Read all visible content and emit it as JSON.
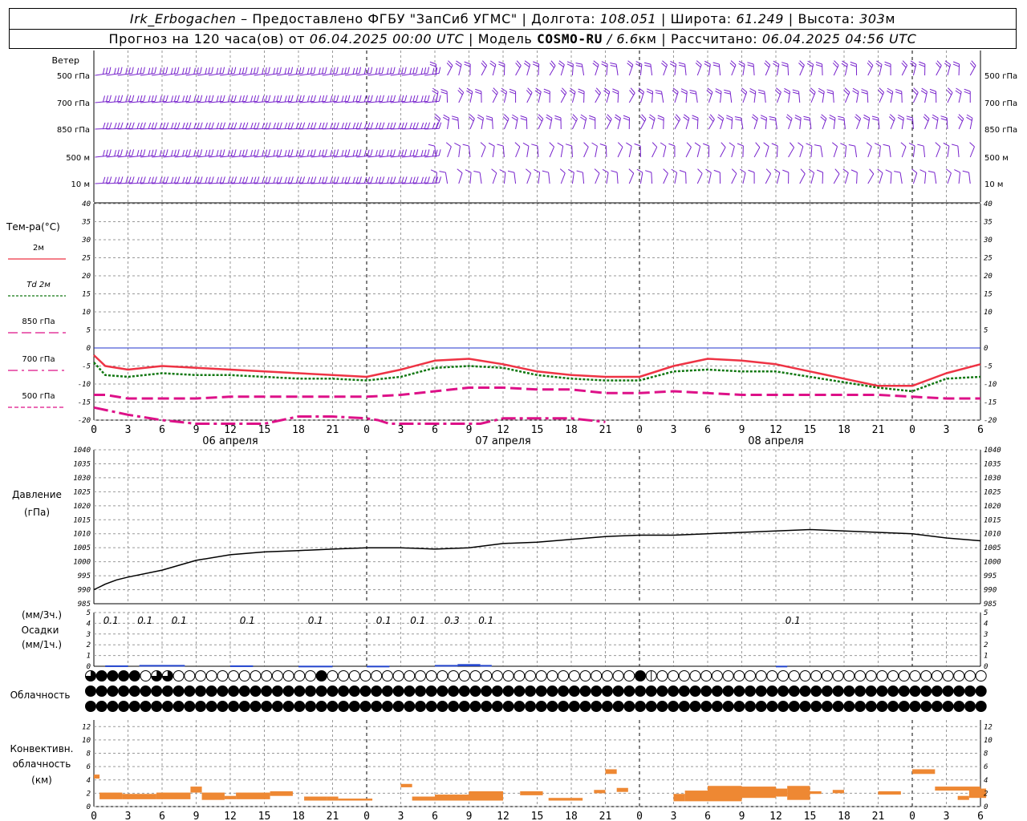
{
  "header": {
    "station": "Irk_Erbogachen",
    "provider": "– Предоставлено ФГБУ \"ЗапСиб УГМС\"",
    "lon_label": "| Долгота:",
    "lon": "108.051",
    "lat_label": "| Широта:",
    "lat": "61.249",
    "alt_label": "| Высота:",
    "alt": "303",
    "alt_unit": "м",
    "forecast_label": "Прогноз на 120 часа(ов) от",
    "forecast_time": "06.04.2025 00:00 UTC",
    "model_label": "| Модель",
    "model": "COSMO-RU",
    "model_res": "/ 6.6",
    "model_res_unit": "км",
    "calc_label": "| Рассчитано:",
    "calc_time": "06.04.2025 04:56 UTC"
  },
  "colors": {
    "t2m": "#ee3344",
    "td2m": "#117711",
    "t850": "#dd1188",
    "t700": "#dd1188",
    "t500": "#dd1188",
    "wind": "#7722cc",
    "pressure": "#000000",
    "precip": "#2244cc",
    "convective": "#ee8833",
    "zero_line": "#2233cc",
    "grid": "#999999"
  },
  "time_axis": {
    "tick_labels": [
      "0",
      "3",
      "6",
      "9",
      "12",
      "15",
      "18",
      "21",
      "0",
      "3",
      "6",
      "9",
      "12",
      "15",
      "18",
      "21",
      "0",
      "3",
      "6",
      "9",
      "12",
      "15",
      "18",
      "21",
      "0",
      "3",
      "6"
    ],
    "day_labels": [
      "06 апреля",
      "07 апреля",
      "08 апреля"
    ]
  },
  "wind_panel": {
    "title": "Ветер",
    "levels": [
      "500 гПа",
      "700 гПа",
      "850 гПа",
      "500 м",
      "10 м"
    ]
  },
  "chart_data": [
    {
      "type": "line",
      "title": "Тем-ра(°C)",
      "ylim": [
        -20,
        40
      ],
      "y_ticks": [
        "40",
        "35",
        "30",
        "25",
        "20",
        "15",
        "10",
        "5",
        "0",
        "-5",
        "-10",
        "-15",
        "-20"
      ],
      "x_hours": [
        0,
        1,
        3,
        6,
        9,
        12,
        15,
        18,
        21,
        24,
        27,
        30,
        33,
        36,
        39,
        42,
        45,
        48,
        51,
        54,
        57,
        60,
        63,
        66,
        69,
        72,
        75,
        78
      ],
      "series": [
        {
          "name": "2м",
          "style": "solid",
          "values": [
            -2,
            -5,
            -6,
            -5,
            -5.5,
            -6,
            -6.5,
            -7,
            -7.5,
            -8,
            -6,
            -3.5,
            -3,
            -4.5,
            -6.5,
            -7.5,
            -8,
            -8,
            -5,
            -3,
            -3.5,
            -4.5,
            -6.5,
            -8.5,
            -10.5,
            -10.5,
            -7,
            -4.5
          ]
        },
        {
          "name": "Td 2м",
          "style": "dotted",
          "values": [
            -4,
            -7.5,
            -8,
            -7,
            -7.5,
            -7.5,
            -8,
            -8.5,
            -8.5,
            -9,
            -8,
            -5.5,
            -5,
            -5.5,
            -7.5,
            -8.5,
            -9,
            -9,
            -6.5,
            -6,
            -6.5,
            -6.5,
            -8,
            -9.5,
            -11,
            -12,
            -8.5,
            -8
          ]
        },
        {
          "name": "850 гПа",
          "style": "dashed",
          "values": [
            -13,
            -13,
            -14,
            -14,
            -14,
            -13.5,
            -13.5,
            -13.5,
            -13.5,
            -13.5,
            -13,
            -12,
            -11,
            -11,
            -11.5,
            -11.5,
            -12.5,
            -12.5,
            -12,
            -12.5,
            -13,
            -13,
            -13,
            -13,
            -13,
            -13.5,
            -14,
            -14
          ]
        },
        {
          "name": "700 гПа",
          "style": "dashdot",
          "x_hours": [
            0,
            3,
            6,
            9,
            12,
            15,
            18,
            21,
            24,
            25,
            26,
            34,
            36,
            39,
            42,
            45
          ],
          "values": [
            -16.5,
            -18.5,
            -20,
            -21.5,
            -22.5,
            -21,
            -19,
            -19,
            -19.5,
            -20,
            -21,
            -21,
            -19.5,
            -19.5,
            -19.5,
            -20.5
          ]
        },
        {
          "name": "500 гПа",
          "style": "dash",
          "values": []
        }
      ]
    },
    {
      "type": "line",
      "title": "Давление",
      "unit": "(гПа)",
      "ylim": [
        985,
        1040
      ],
      "y_ticks": [
        "1040",
        "1035",
        "1030",
        "1025",
        "1020",
        "1015",
        "1010",
        "1005",
        "1000",
        "995",
        "990",
        "985"
      ],
      "series": [
        {
          "name": "Давление",
          "x_hours": [
            0,
            1,
            2,
            3,
            6,
            9,
            12,
            15,
            18,
            21,
            24,
            27,
            30,
            33,
            36,
            39,
            42,
            45,
            48,
            51,
            54,
            57,
            60,
            63,
            66,
            69,
            72,
            75,
            78
          ],
          "values": [
            990,
            992,
            993.5,
            994.5,
            997,
            1000.5,
            1002.5,
            1003.5,
            1004,
            1004.5,
            1005,
            1005,
            1004.5,
            1005,
            1006.5,
            1007,
            1008,
            1009,
            1009.5,
            1009.5,
            1010,
            1010.5,
            1011,
            1011.5,
            1011,
            1010.5,
            1010,
            1008.5,
            1007.5
          ]
        }
      ]
    },
    {
      "type": "bar",
      "title": "Осадки",
      "unit_3h": "(мм/3ч.)",
      "unit_1h": "(мм/1ч.)",
      "ylim": [
        0,
        5
      ],
      "y_ticks": [
        "5",
        "4",
        "3",
        "2",
        "1",
        "0"
      ],
      "labels": [
        {
          "x_hours": 1.5,
          "text": "0.1"
        },
        {
          "x_hours": 4.5,
          "text": "0.1"
        },
        {
          "x_hours": 7.5,
          "text": "0.1"
        },
        {
          "x_hours": 13.5,
          "text": "0.1"
        },
        {
          "x_hours": 19.5,
          "text": "0.1"
        },
        {
          "x_hours": 25.5,
          "text": "0.1"
        },
        {
          "x_hours": 28.5,
          "text": "0.1"
        },
        {
          "x_hours": 31.5,
          "text": "0.3"
        },
        {
          "x_hours": 34.5,
          "text": "0.1"
        },
        {
          "x_hours": 61.5,
          "text": "0.1"
        }
      ],
      "bars": [
        {
          "x_hours": 1,
          "w": 2,
          "value": 0.08
        },
        {
          "x_hours": 4,
          "w": 4,
          "value": 0.12
        },
        {
          "x_hours": 12,
          "w": 2,
          "value": 0.08
        },
        {
          "x_hours": 18,
          "w": 3,
          "value": 0.05
        },
        {
          "x_hours": 24,
          "w": 2,
          "value": 0.05
        },
        {
          "x_hours": 30,
          "w": 2,
          "value": 0.12
        },
        {
          "x_hours": 32,
          "w": 2,
          "value": 0.2
        },
        {
          "x_hours": 34,
          "w": 1,
          "value": 0.12
        },
        {
          "x_hours": 60,
          "w": 1,
          "value": 0.05
        }
      ]
    },
    {
      "type": "bar",
      "title": "Конвективн. облачность",
      "unit": "(км)",
      "ylim": [
        0,
        13
      ],
      "y_ticks": [
        "12",
        "10",
        "8",
        "6",
        "4",
        "2",
        "0"
      ],
      "bars": [
        {
          "x_hours": 0,
          "w": 0.5,
          "top": 4.8,
          "base": 4.2
        },
        {
          "x_hours": 0.5,
          "w": 2,
          "top": 2.1,
          "base": 1.1
        },
        {
          "x_hours": 2.5,
          "w": 3,
          "top": 1.9,
          "base": 1.1
        },
        {
          "x_hours": 5.5,
          "w": 3,
          "top": 2.1,
          "base": 1.1
        },
        {
          "x_hours": 8.5,
          "w": 1,
          "top": 3.0,
          "base": 2.1
        },
        {
          "x_hours": 9.5,
          "w": 2,
          "top": 2.1,
          "base": 1.0
        },
        {
          "x_hours": 11.5,
          "w": 1,
          "top": 1.6,
          "base": 1.1
        },
        {
          "x_hours": 12.5,
          "w": 3,
          "top": 2.1,
          "base": 1.1
        },
        {
          "x_hours": 15.5,
          "w": 2,
          "top": 2.3,
          "base": 1.6
        },
        {
          "x_hours": 18.5,
          "w": 2,
          "top": 1.5,
          "base": 0.9
        },
        {
          "x_hours": 20.5,
          "w": 1,
          "top": 1.5,
          "base": 0.9
        },
        {
          "x_hours": 21.5,
          "w": 3,
          "top": 1.2,
          "base": 0.9
        },
        {
          "x_hours": 27,
          "w": 1,
          "top": 3.4,
          "base": 2.9
        },
        {
          "x_hours": 28,
          "w": 2,
          "top": 1.5,
          "base": 0.9
        },
        {
          "x_hours": 30,
          "w": 3,
          "top": 1.8,
          "base": 0.9
        },
        {
          "x_hours": 33,
          "w": 3,
          "top": 2.3,
          "base": 0.9
        },
        {
          "x_hours": 37.5,
          "w": 2,
          "top": 2.3,
          "base": 1.7
        },
        {
          "x_hours": 40,
          "w": 3,
          "top": 1.3,
          "base": 0.9
        },
        {
          "x_hours": 44,
          "w": 1,
          "top": 2.5,
          "base": 2.0
        },
        {
          "x_hours": 45,
          "w": 1,
          "top": 5.6,
          "base": 4.9
        },
        {
          "x_hours": 46,
          "w": 1,
          "top": 2.8,
          "base": 2.2
        },
        {
          "x_hours": 51,
          "w": 1,
          "top": 1.9,
          "base": 0.8
        },
        {
          "x_hours": 52,
          "w": 2,
          "top": 2.4,
          "base": 0.8
        },
        {
          "x_hours": 54,
          "w": 3,
          "top": 3.1,
          "base": 0.8
        },
        {
          "x_hours": 57,
          "w": 3,
          "top": 3.0,
          "base": 1.3
        },
        {
          "x_hours": 60,
          "w": 1,
          "top": 2.7,
          "base": 1.5
        },
        {
          "x_hours": 61,
          "w": 2,
          "top": 3.1,
          "base": 1.0
        },
        {
          "x_hours": 63,
          "w": 1,
          "top": 2.3,
          "base": 1.9
        },
        {
          "x_hours": 65,
          "w": 1,
          "top": 2.5,
          "base": 2.0
        },
        {
          "x_hours": 69,
          "w": 2,
          "top": 2.3,
          "base": 1.8
        },
        {
          "x_hours": 72,
          "w": 2,
          "top": 5.6,
          "base": 4.9
        },
        {
          "x_hours": 74,
          "w": 4,
          "top": 3.0,
          "base": 2.4
        },
        {
          "x_hours": 76,
          "w": 1,
          "top": 1.6,
          "base": 1.0
        },
        {
          "x_hours": 77,
          "w": 1.5,
          "top": 2.7,
          "base": 1.3
        }
      ]
    }
  ],
  "temp_legend": [
    {
      "label": "2м",
      "style": "solid"
    },
    {
      "label": "Td  2м",
      "style": "dotted",
      "italic_prefix": "Td"
    },
    {
      "label": "850 гПа",
      "style": "dash"
    },
    {
      "label": "700 гПа",
      "style": "dashdot"
    },
    {
      "label": "500 гПа",
      "style": "dashdot2"
    }
  ],
  "cloud_panel": {
    "title": "Облачность",
    "rows": [
      "H1111ABBAAAAAAAAAAAAA1AAAAAAAAAAAAAAAAAAAAAAAAAAAA1CAAAAAAAAAAAAAAAAAAAAAAAAAAAAAA",
      "1111111111111111111111111111111111111111111111111111111111111111111111111111111111",
      "1111111111111111111111111111111111111111111111111111111111111111111111111111111111"
    ]
  }
}
